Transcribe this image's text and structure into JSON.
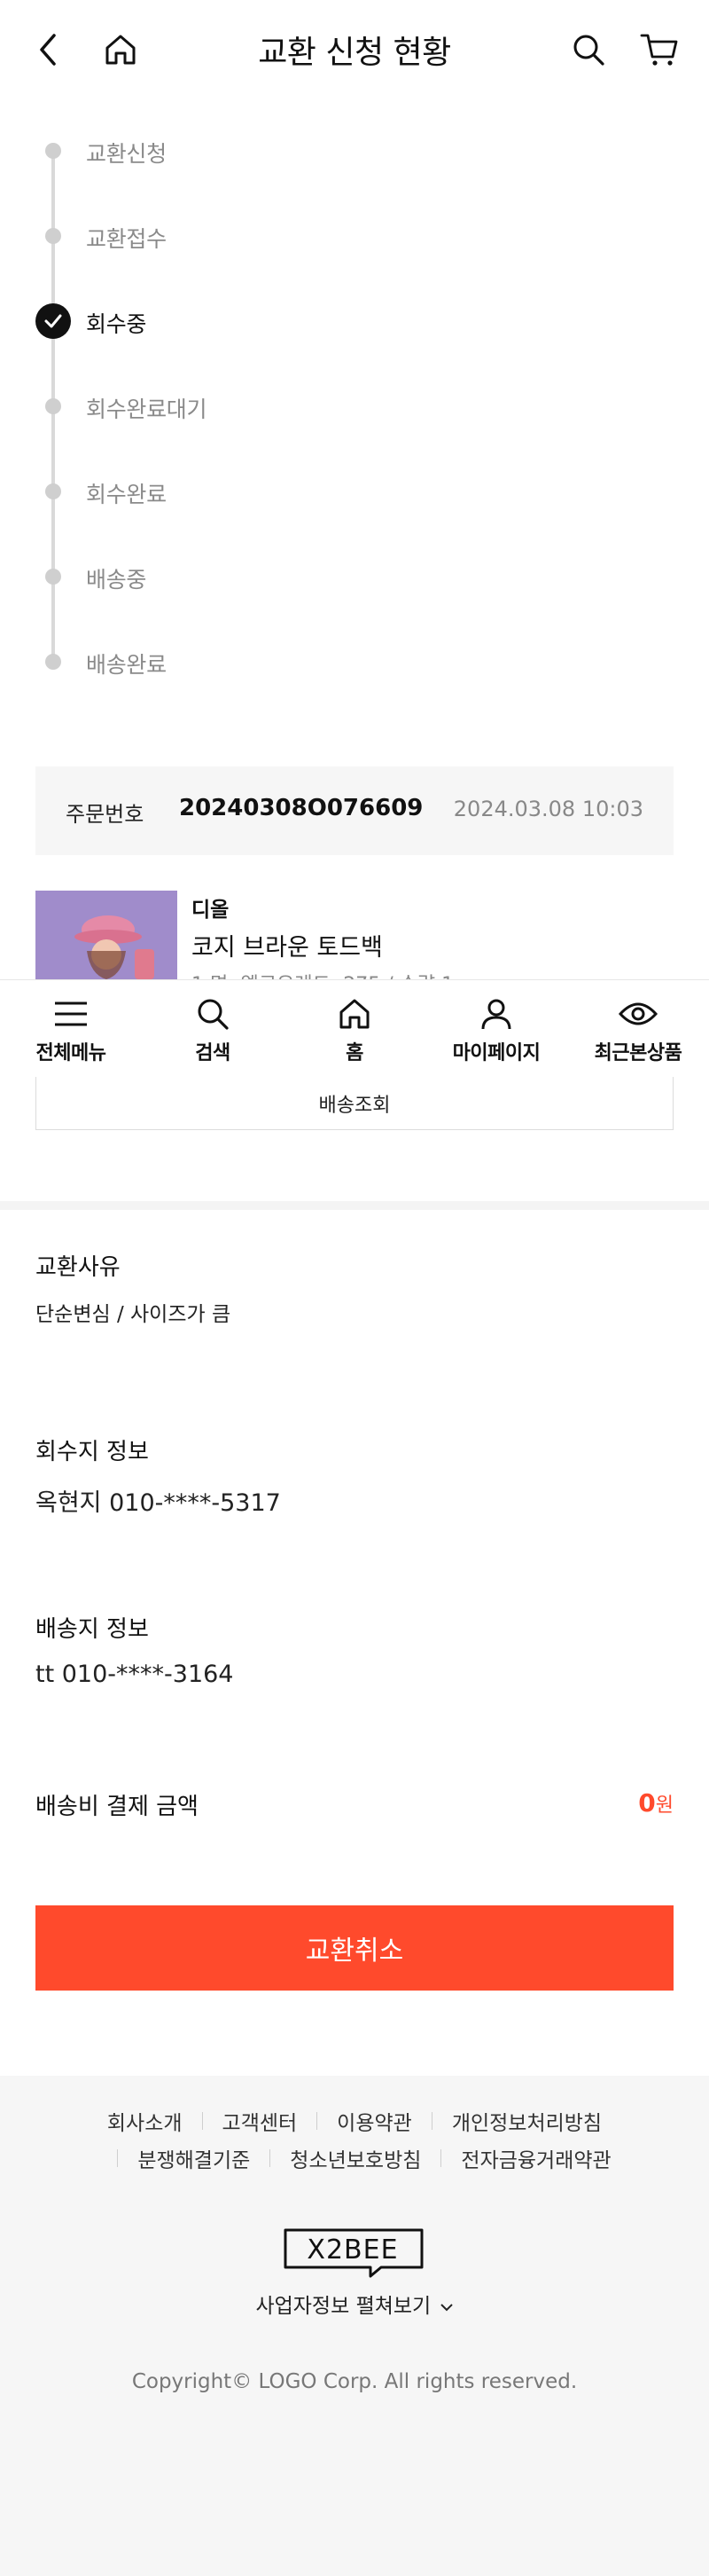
{
  "header": {
    "title": "교환 신청 현황",
    "icons": [
      "back-arrow-icon",
      "home-icon",
      "search-icon",
      "cart-icon"
    ]
  },
  "steps": [
    {
      "label": "교환신청",
      "active": false
    },
    {
      "label": "교환접수",
      "active": false
    },
    {
      "label": "회수중",
      "active": true
    },
    {
      "label": "회수완료대기",
      "active": false
    },
    {
      "label": "회수완료",
      "active": false
    },
    {
      "label": "배송중",
      "active": false
    },
    {
      "label": "배송완료",
      "active": false
    }
  ],
  "order": {
    "label": "주문번호",
    "number": "20240308O076609",
    "date": "2024.03.08 10:03"
  },
  "product": {
    "brand": "디올",
    "name": "코지 브라운 토드백",
    "option": "1 명: 엘로우레드: 275 / 수량 1"
  },
  "bottom_nav": [
    {
      "label": "전체메뉴",
      "icon": "menu-icon"
    },
    {
      "label": "검색",
      "icon": "search-icon"
    },
    {
      "label": "홈",
      "icon": "home-icon"
    },
    {
      "label": "마이페이지",
      "icon": "user-icon"
    },
    {
      "label": "최근본상품",
      "icon": "eye-icon"
    }
  ],
  "tracking_button": "배송조회",
  "reason": {
    "title": "교환사유",
    "text": "단순변심 / 사이즈가 큼"
  },
  "pickup": {
    "title": "회수지 정보",
    "text": "옥현지 010-****-5317"
  },
  "delivery": {
    "title": "배송지 정보",
    "text": "tt 010-****-3164"
  },
  "fee": {
    "title": "배송비 결제 금액",
    "amount": "0",
    "unit": "원"
  },
  "cancel_button": "교환취소",
  "footer": {
    "links_row1": [
      "회사소개",
      "고객센터",
      "이용약관",
      "개인정보처리방침"
    ],
    "links_row2": [
      "분쟁해결기준",
      "청소년보호방침",
      "전자금융거래약관"
    ],
    "logo_text": "X2BEE",
    "business_info_toggle": "사업자정보 펼쳐보기",
    "copyright": "Copyright© LOGO Corp. All rights reserved."
  },
  "colors": {
    "accent": "#ff4a2c",
    "step_active": "#111111",
    "step_inactive": "#cfcfcf",
    "footer_bg": "#f6f6f6"
  }
}
